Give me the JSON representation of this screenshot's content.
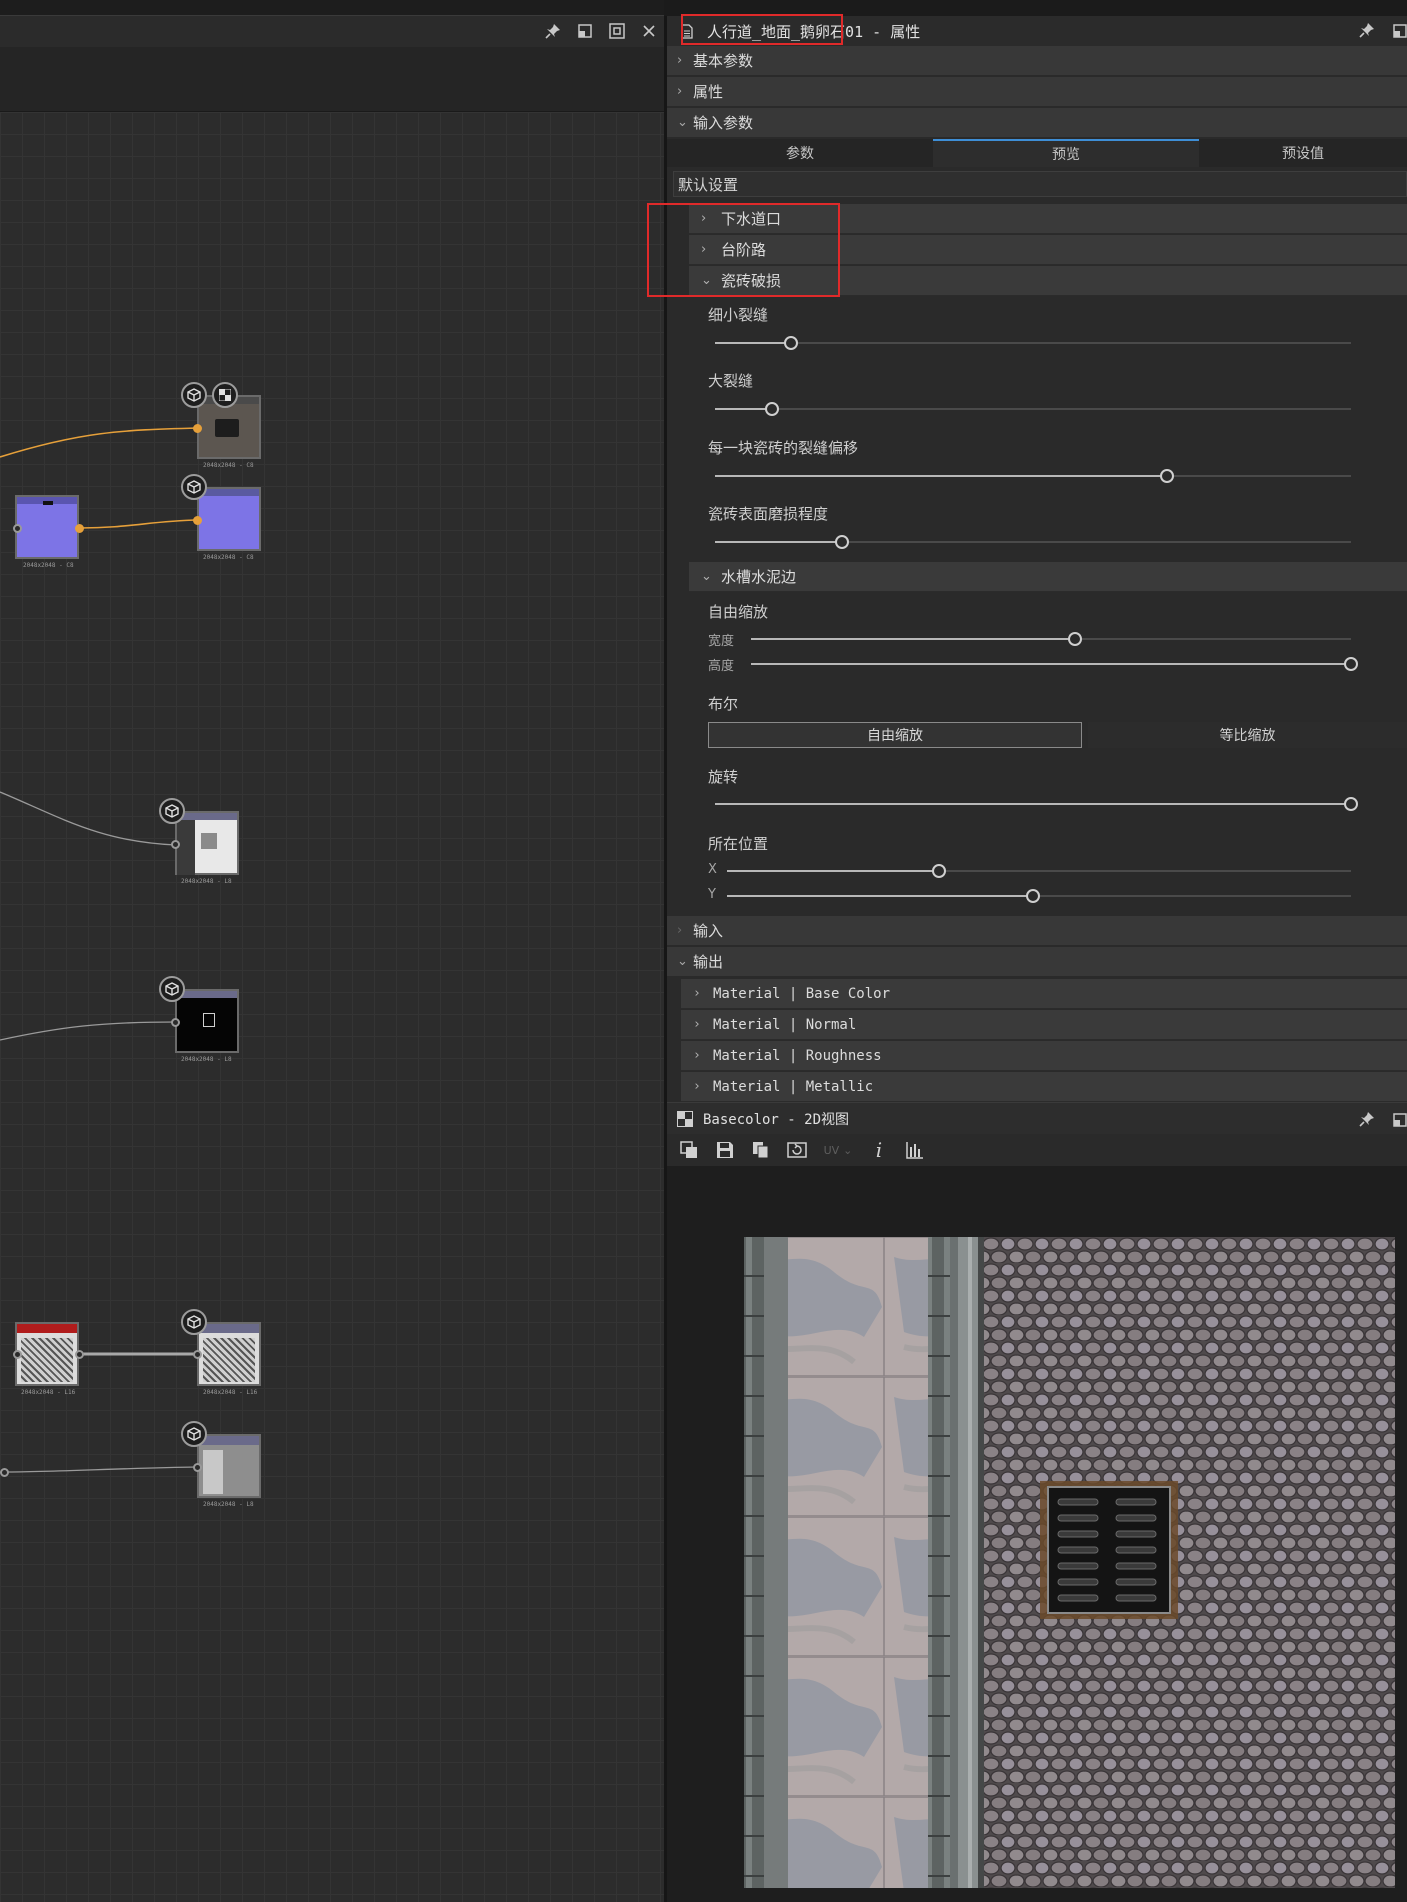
{
  "graph": {
    "header_icons": [
      "pin-icon",
      "float-icon",
      "maximize-icon",
      "close-icon"
    ],
    "nodes": [
      {
        "id": "n1",
        "label": "2048x2048 - C8"
      },
      {
        "id": "n2",
        "label": "2048x2048 - C8"
      },
      {
        "id": "n3",
        "label": "2048x2048 - C8"
      },
      {
        "id": "n4",
        "label": "2048x2048 - L8"
      },
      {
        "id": "n5",
        "label": "2048x2048 - L8"
      },
      {
        "id": "n6",
        "label": "2048x2048 - L16"
      },
      {
        "id": "n7",
        "label": "2048x2048 - L16"
      },
      {
        "id": "n8",
        "label": "2048x2048 - L8"
      }
    ]
  },
  "properties": {
    "title": "人行道_地面_鹅卵石01 - 属性",
    "sections": {
      "basic": "基本参数",
      "attributes": "属性",
      "input_params": "输入参数",
      "input": "输入",
      "output": "输出"
    },
    "tabs": [
      {
        "label": "参数"
      },
      {
        "label": "预览"
      },
      {
        "label": "预设值"
      }
    ],
    "preset_value": "默认设置",
    "groups": {
      "drain": "下水道口",
      "steps": "台阶路",
      "tile_damage": "瓷砖破损",
      "gutter": "水槽水泥边"
    },
    "tile_damage_params": [
      {
        "label": "细小裂缝",
        "value": 0.12
      },
      {
        "label": "大裂缝",
        "value": 0.09
      },
      {
        "label": "每一块瓷砖的裂缝偏移",
        "value": 0.71
      },
      {
        "label": "瓷砖表面磨损程度",
        "value": 0.2
      }
    ],
    "gutter_params": {
      "scale_label": "自由缩放",
      "width_label": "宽度",
      "width_value": 0.54,
      "height_label": "高度",
      "height_value": 1.0,
      "bool_label": "布尔",
      "bool_options": [
        "自由缩放",
        "等比缩放"
      ],
      "rotation_label": "旋转",
      "rotation_value": 1.0,
      "position_label": "所在位置",
      "x_label": "X",
      "x_value": 0.34,
      "y_label": "Y",
      "y_value": 0.49
    },
    "outputs": [
      {
        "label": "Material | Base Color"
      },
      {
        "label": "Material | Normal"
      },
      {
        "label": "Material | Roughness"
      },
      {
        "label": "Material | Metallic"
      }
    ]
  },
  "view2d": {
    "title": "Basecolor - 2D视图",
    "toolbar_icons": [
      "layers-icon",
      "save-icon",
      "copy-icon",
      "refresh-icon",
      "uv-icon",
      "info-icon",
      "histogram-icon"
    ],
    "uv_label": "UV"
  }
}
